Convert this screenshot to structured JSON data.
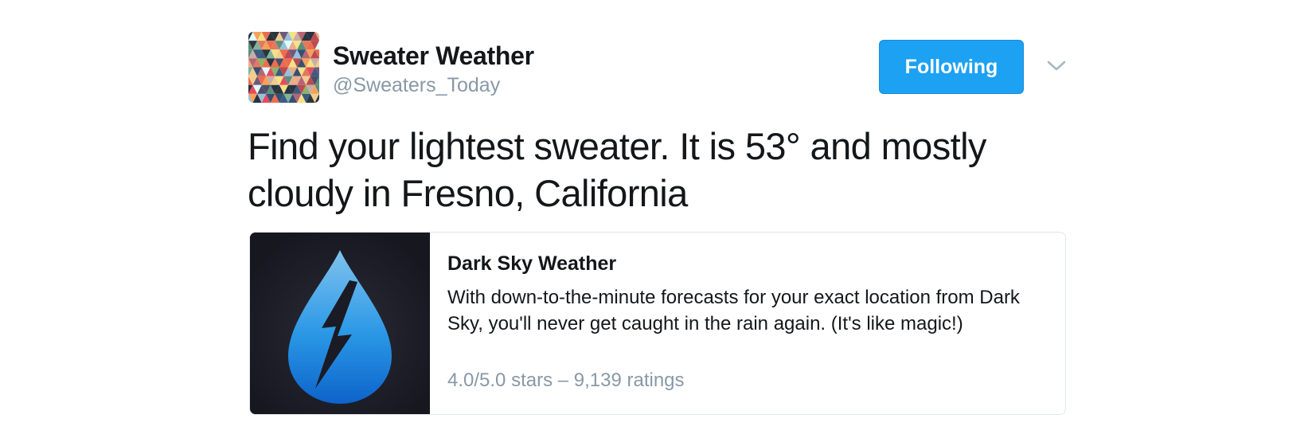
{
  "user": {
    "display_name": "Sweater Weather",
    "handle": "@Sweaters_Today",
    "avatar_icon": "triangle-mosaic-avatar"
  },
  "follow_button": {
    "label": "Following"
  },
  "menu": {
    "icon": "chevron-down-icon"
  },
  "tweet": {
    "text": "Find your lightest sweater. It is 53° and mostly cloudy in Fresno, California"
  },
  "card": {
    "image_icon": "dark-sky-raindrop-lightning-icon",
    "title": "Dark Sky Weather",
    "description": "With down-to-the-minute forecasts for your exact location from Dark Sky, you'll never get caught in the rain again. (It's like magic!)",
    "rating": "4.0/5.0 stars – 9,139 ratings"
  },
  "colors": {
    "accent": "#1da1f2",
    "handle_gray": "#8899a6",
    "card_bg_dark": "#1a1b24"
  }
}
